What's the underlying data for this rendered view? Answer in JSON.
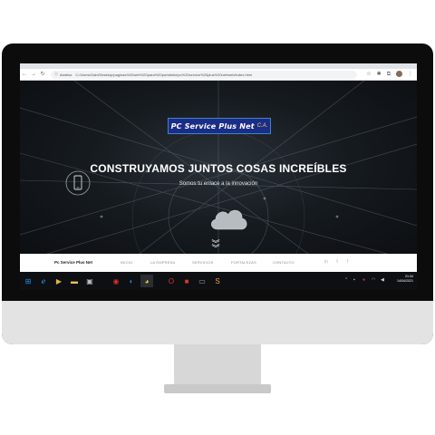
{
  "browser": {
    "url_label": "Archivo",
    "url": "C:/Users/Gabi/Desktop/paginas%20web%20para%20portafolio/pc%20service%20plus%20net/web/index.html"
  },
  "logo": {
    "text": "PC Service Plus Net",
    "suffix": "C.A."
  },
  "hero": {
    "title": "CONSTRUYAMOS JUNTOS COSAS INCREÍBLES",
    "subtitle": "Somos tu enlace a la innovación"
  },
  "sitenav": {
    "brand": "Pc Service Plus Net",
    "items": [
      "INICIO",
      "LA EMPRESA",
      "SERVICIOS",
      "FORTALEZAS",
      "CONTACTO"
    ],
    "social": [
      "in",
      "𝕥",
      "f"
    ]
  },
  "taskbar": {
    "time": "21:34",
    "date": "14/04/2021"
  },
  "colors": {
    "accent_blue": "#1b2d86",
    "taskbar": "#0d0f13",
    "hero_bg": "#161b20"
  }
}
